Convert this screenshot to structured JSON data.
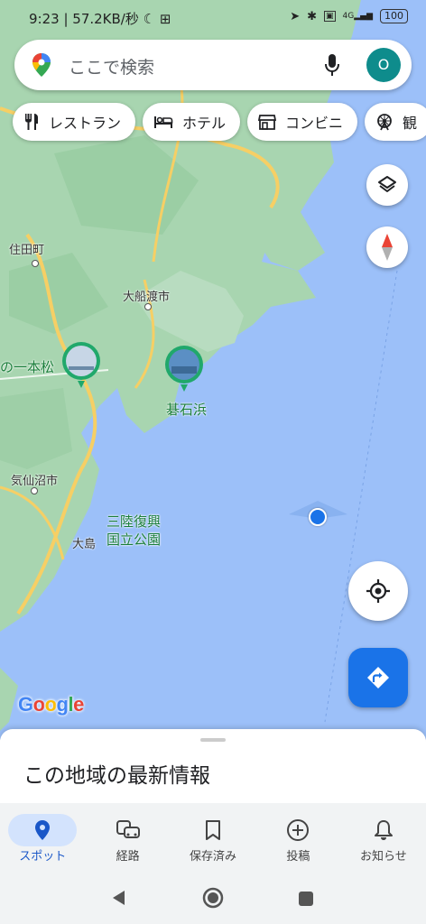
{
  "status_bar": {
    "time": "9:23",
    "network_speed": "57.2KB/秒",
    "battery": "100",
    "signal_label": "4G"
  },
  "search": {
    "placeholder": "ここで検索",
    "avatar_letter": "O"
  },
  "chips": [
    {
      "label": "レストラン",
      "icon": "utensils-icon"
    },
    {
      "label": "ホテル",
      "icon": "bed-icon"
    },
    {
      "label": "コンビニ",
      "icon": "store-icon"
    },
    {
      "label": "観",
      "icon": "ferris-wheel-icon"
    }
  ],
  "map": {
    "labels": {
      "sumita": "住田町",
      "ofunato": "大船渡市",
      "ipponmatsu": "の一本松",
      "goishihama": "碁石浜",
      "kesennuma": "気仙沼市",
      "sanriku_1": "三陸復興",
      "sanriku_2": "国立公園",
      "oshima": "大島"
    },
    "google_logo": "Google"
  },
  "sheet": {
    "title": "この地域の最新情報"
  },
  "bottom_nav": [
    {
      "label": "スポット",
      "icon": "location-pin-icon",
      "active": true
    },
    {
      "label": "経路",
      "icon": "commute-icon",
      "active": false
    },
    {
      "label": "保存済み",
      "icon": "bookmark-icon",
      "active": false
    },
    {
      "label": "投稿",
      "icon": "add-circle-icon",
      "active": false
    },
    {
      "label": "お知らせ",
      "icon": "bell-icon",
      "active": false
    }
  ],
  "colors": {
    "water": "#9cc0f9",
    "land": "#a8d5b0",
    "road": "#f6cf65",
    "accent": "#1a73e8"
  }
}
